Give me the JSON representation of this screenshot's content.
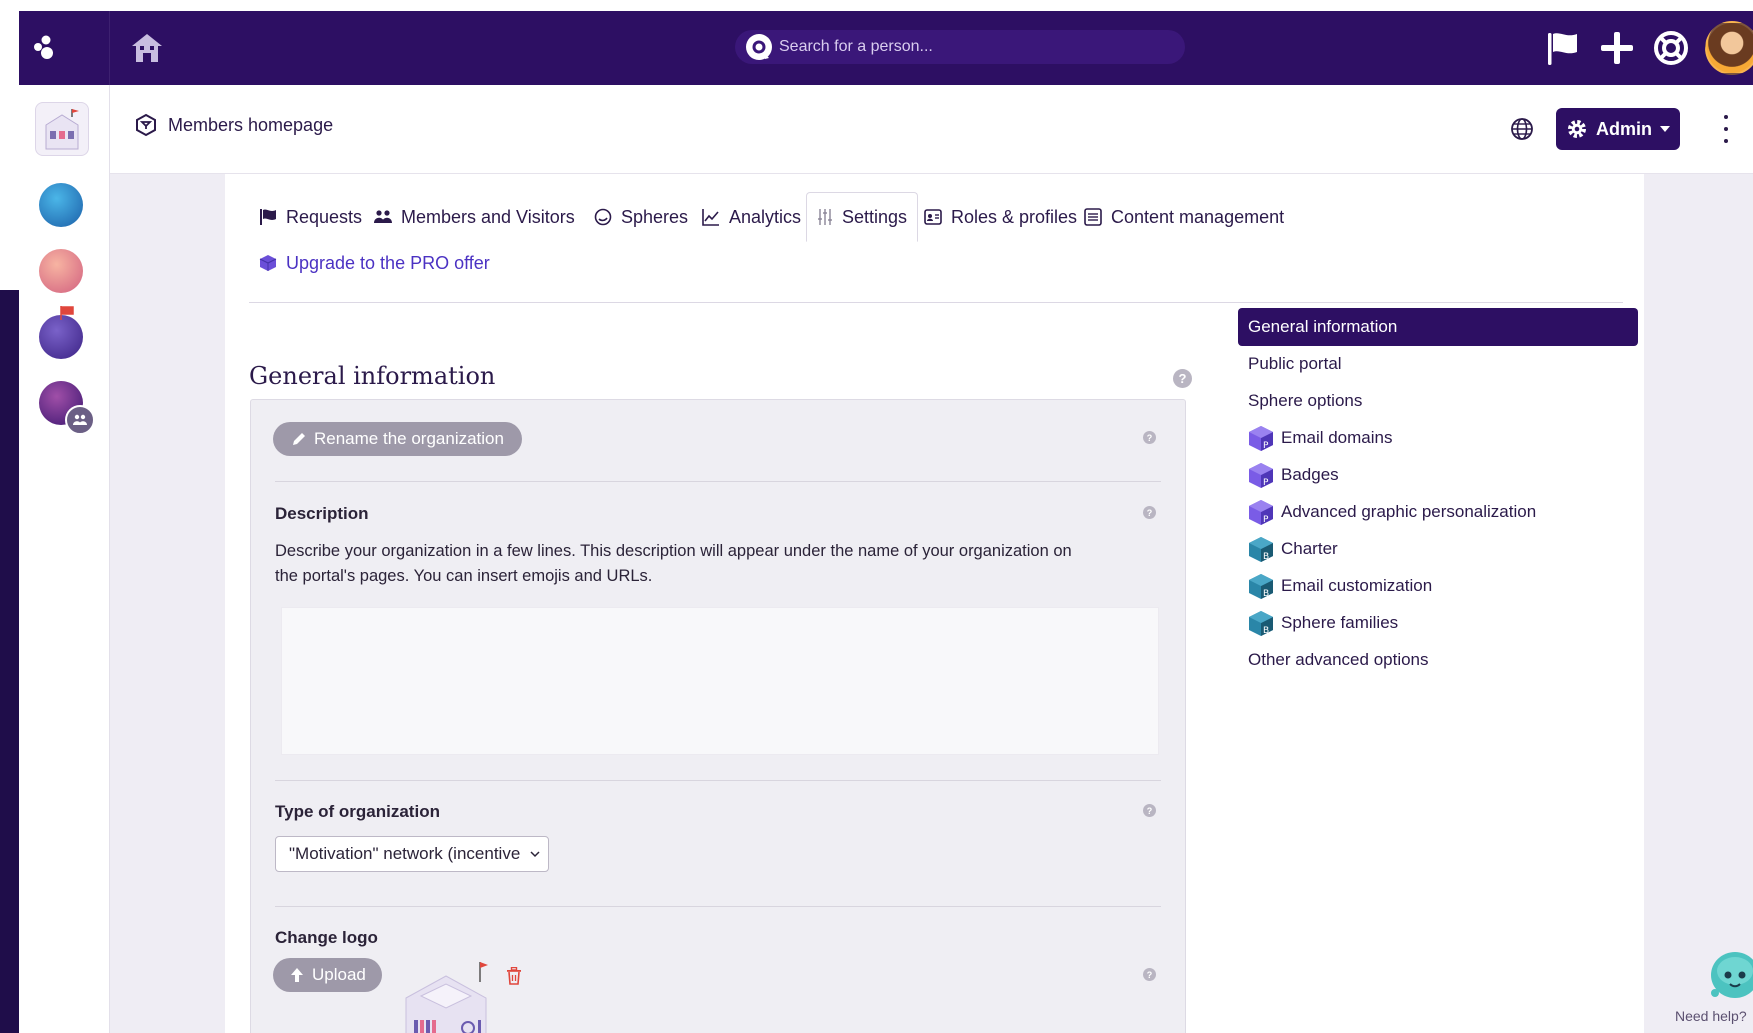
{
  "topbar": {
    "search_placeholder": "Search for a person..."
  },
  "header": {
    "breadcrumb": "Members homepage",
    "admin_label": "Admin"
  },
  "tabs": [
    {
      "label": "Requests",
      "icon": "flag-icon"
    },
    {
      "label": "Members and Visitors",
      "icon": "users-icon"
    },
    {
      "label": "Spheres",
      "icon": "sphere-icon"
    },
    {
      "label": "Analytics",
      "icon": "chart-line-icon"
    },
    {
      "label": "Settings",
      "icon": "sliders-icon",
      "active": true
    },
    {
      "label": "Roles & profiles",
      "icon": "id-card-icon"
    },
    {
      "label": "Content management",
      "icon": "list-icon"
    },
    {
      "label": "Upgrade to the PRO offer",
      "icon": "cube-icon"
    }
  ],
  "main": {
    "section_title": "General information",
    "rename_label": "Rename the organization",
    "description_label": "Description",
    "description_text_line1": "Describe your organization in a few lines. This description will appear under the name of your organization on",
    "description_text_line2": "the portal's pages. You can insert emojis and URLs.",
    "org_type_label": "Type of organization",
    "org_type_value": "\"Motivation\" network (incentive",
    "change_logo_label": "Change logo",
    "upload_label": "Upload"
  },
  "side_nav": [
    {
      "label": "General information",
      "active": true
    },
    {
      "label": "Public portal"
    },
    {
      "label": "Sphere options"
    },
    {
      "label": "Email domains",
      "icon": "pro-cube-icon",
      "icon_color": "#6b4fd8"
    },
    {
      "label": "Badges",
      "icon": "pro-cube-icon",
      "icon_color": "#6b4fd8"
    },
    {
      "label": "Advanced graphic personalization",
      "icon": "pro-cube-icon",
      "icon_color": "#6b4fd8"
    },
    {
      "label": "Charter",
      "icon": "business-cube-icon",
      "icon_color": "#1f6f8b"
    },
    {
      "label": "Email customization",
      "icon": "business-cube-icon",
      "icon_color": "#1f6f8b"
    },
    {
      "label": "Sphere families",
      "icon": "business-cube-icon",
      "icon_color": "#1f6f8b"
    },
    {
      "label": "Other advanced options"
    }
  ],
  "help_widget": {
    "label": "Need help?"
  },
  "colors": {
    "brand_dark": "#2d0f63",
    "accent_link": "#4b32c3",
    "danger": "#e0463c"
  }
}
